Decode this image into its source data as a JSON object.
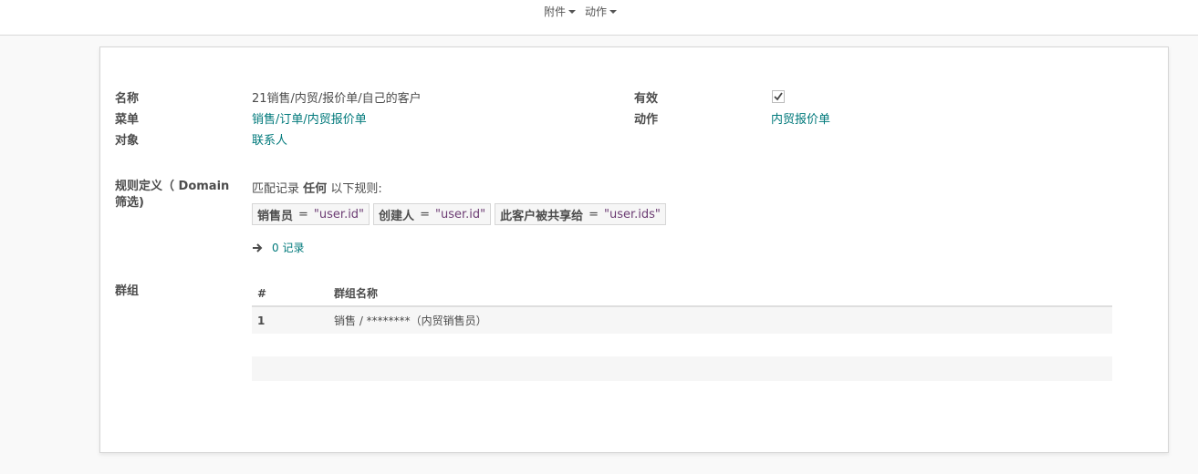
{
  "topbar": {
    "attachments": "附件",
    "action": "动作"
  },
  "form": {
    "name_label": "名称",
    "name_value": "21销售/内贸/报价单/自己的客户",
    "menu_label": "菜单",
    "menu_value": "销售/订单/内贸报价单",
    "object_label": "对象",
    "object_value": "联系人",
    "active_label": "有效",
    "active_checked": true,
    "action_label": "动作",
    "action_value": "内贸报价单",
    "domain_label": "规则定义（ Domain 筛选)",
    "match_prefix": "匹配记录",
    "match_bold": "任何",
    "match_suffix": "以下规则:",
    "rules": [
      {
        "field": "销售员",
        "op": "=",
        "value": "\"user.id\""
      },
      {
        "field": "创建人",
        "op": "=",
        "value": "\"user.id\""
      },
      {
        "field": "此客户被共享给",
        "op": "=",
        "value": "\"user.ids\""
      }
    ],
    "records_text": "0 记录",
    "groups_label": "群组"
  },
  "groups_table": {
    "headers": [
      "#",
      "群组名称"
    ],
    "rows": [
      {
        "num": "1",
        "name": "销售 / ********（内贸销售员）"
      }
    ]
  }
}
